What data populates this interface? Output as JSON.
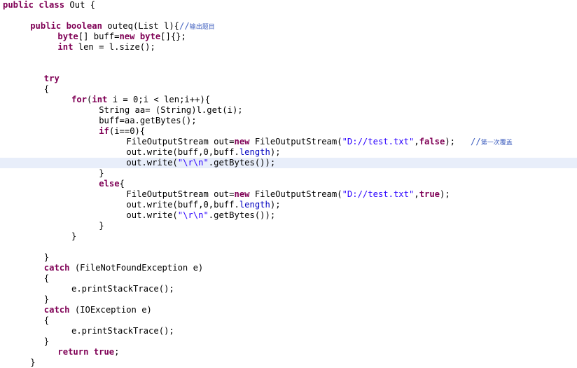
{
  "editor": {
    "language": "Java",
    "class_name": "Out",
    "method_name": "outeq",
    "highlighted_line_number": 15,
    "colors": {
      "background": "#FFFFFF",
      "foreground": "#000000",
      "keyword": "#7F0055",
      "string": "#2A00FF",
      "comment": "#3F5FBF",
      "current_line_highlight": "#E8EEFA"
    }
  },
  "code": {
    "lines": [
      {
        "n": 1,
        "indent": 0,
        "highlight": false,
        "tokens": [
          {
            "t": "kw",
            "v": "public"
          },
          {
            "t": "plain",
            "v": " "
          },
          {
            "t": "kw",
            "v": "class"
          },
          {
            "t": "plain",
            "v": " Out {"
          }
        ]
      },
      {
        "n": 2,
        "indent": 0,
        "highlight": false,
        "tokens": []
      },
      {
        "n": 3,
        "indent": 2,
        "highlight": false,
        "tokens": [
          {
            "t": "kw",
            "v": "public"
          },
          {
            "t": "plain",
            "v": " "
          },
          {
            "t": "kw",
            "v": "boolean"
          },
          {
            "t": "plain",
            "v": " outeq(List l){"
          },
          {
            "t": "cmt",
            "v": "//"
          },
          {
            "t": "cmt-cjk",
            "v": "输出题目"
          }
        ]
      },
      {
        "n": 4,
        "indent": 4,
        "highlight": false,
        "tokens": [
          {
            "t": "kw",
            "v": "byte"
          },
          {
            "t": "plain",
            "v": "[] buff="
          },
          {
            "t": "kw",
            "v": "new"
          },
          {
            "t": "plain",
            "v": " "
          },
          {
            "t": "kw",
            "v": "byte"
          },
          {
            "t": "plain",
            "v": "[]{};"
          }
        ]
      },
      {
        "n": 5,
        "indent": 4,
        "highlight": false,
        "tokens": [
          {
            "t": "kw",
            "v": "int"
          },
          {
            "t": "plain",
            "v": " len = l.size();"
          }
        ]
      },
      {
        "n": 6,
        "indent": 0,
        "highlight": false,
        "tokens": []
      },
      {
        "n": 7,
        "indent": 0,
        "highlight": false,
        "tokens": []
      },
      {
        "n": 8,
        "indent": 3,
        "highlight": false,
        "tokens": [
          {
            "t": "kw",
            "v": "try"
          }
        ]
      },
      {
        "n": 9,
        "indent": 3,
        "highlight": false,
        "tokens": [
          {
            "t": "plain",
            "v": "{"
          }
        ]
      },
      {
        "n": 10,
        "indent": 5,
        "highlight": false,
        "tokens": [
          {
            "t": "kw",
            "v": "for"
          },
          {
            "t": "plain",
            "v": "("
          },
          {
            "t": "kw",
            "v": "int"
          },
          {
            "t": "plain",
            "v": " i = 0;i < len;i++){"
          }
        ]
      },
      {
        "n": 11,
        "indent": 7,
        "highlight": false,
        "tokens": [
          {
            "t": "plain",
            "v": "String aa= (String)l.get(i);"
          }
        ]
      },
      {
        "n": 12,
        "indent": 7,
        "highlight": false,
        "tokens": [
          {
            "t": "plain",
            "v": "buff=aa.getBytes();"
          }
        ]
      },
      {
        "n": 13,
        "indent": 7,
        "highlight": false,
        "tokens": [
          {
            "t": "kw",
            "v": "if"
          },
          {
            "t": "plain",
            "v": "(i==0){"
          }
        ]
      },
      {
        "n": 14,
        "indent": 9,
        "highlight": false,
        "tokens": [
          {
            "t": "plain",
            "v": "FileOutputStream out="
          },
          {
            "t": "kw",
            "v": "new"
          },
          {
            "t": "plain",
            "v": " FileOutputStream("
          },
          {
            "t": "str",
            "v": "\"D://test.txt\""
          },
          {
            "t": "plain",
            "v": ","
          },
          {
            "t": "kw",
            "v": "false"
          },
          {
            "t": "plain",
            "v": ");   "
          },
          {
            "t": "cmt",
            "v": "//"
          },
          {
            "t": "cmt-cjk",
            "v": "第一次覆盖"
          }
        ]
      },
      {
        "n": 15,
        "indent": 9,
        "highlight": false,
        "tokens": [
          {
            "t": "plain",
            "v": "out.write(buff,0,buff."
          },
          {
            "t": "fld",
            "v": "length"
          },
          {
            "t": "plain",
            "v": ");"
          }
        ]
      },
      {
        "n": 16,
        "indent": 9,
        "highlight": true,
        "tokens": [
          {
            "t": "plain",
            "v": "out.write("
          },
          {
            "t": "str",
            "v": "\"\\r\\n\""
          },
          {
            "t": "plain",
            "v": ".getBytes());"
          }
        ]
      },
      {
        "n": 17,
        "indent": 7,
        "highlight": false,
        "tokens": [
          {
            "t": "plain",
            "v": "}"
          }
        ]
      },
      {
        "n": 18,
        "indent": 7,
        "highlight": false,
        "tokens": [
          {
            "t": "kw",
            "v": "else"
          },
          {
            "t": "plain",
            "v": "{"
          }
        ]
      },
      {
        "n": 19,
        "indent": 9,
        "highlight": false,
        "tokens": [
          {
            "t": "plain",
            "v": "FileOutputStream out="
          },
          {
            "t": "kw",
            "v": "new"
          },
          {
            "t": "plain",
            "v": " FileOutputStream("
          },
          {
            "t": "str",
            "v": "\"D://test.txt\""
          },
          {
            "t": "plain",
            "v": ","
          },
          {
            "t": "kw",
            "v": "true"
          },
          {
            "t": "plain",
            "v": ");"
          }
        ]
      },
      {
        "n": 20,
        "indent": 9,
        "highlight": false,
        "tokens": [
          {
            "t": "plain",
            "v": "out.write(buff,0,buff."
          },
          {
            "t": "fld",
            "v": "length"
          },
          {
            "t": "plain",
            "v": ");"
          }
        ]
      },
      {
        "n": 21,
        "indent": 9,
        "highlight": false,
        "tokens": [
          {
            "t": "plain",
            "v": "out.write("
          },
          {
            "t": "str",
            "v": "\"\\r\\n\""
          },
          {
            "t": "plain",
            "v": ".getBytes());"
          }
        ]
      },
      {
        "n": 22,
        "indent": 7,
        "highlight": false,
        "tokens": [
          {
            "t": "plain",
            "v": "}"
          }
        ]
      },
      {
        "n": 23,
        "indent": 5,
        "highlight": false,
        "tokens": [
          {
            "t": "plain",
            "v": "}"
          }
        ]
      },
      {
        "n": 24,
        "indent": 0,
        "highlight": false,
        "tokens": []
      },
      {
        "n": 25,
        "indent": 3,
        "highlight": false,
        "tokens": [
          {
            "t": "plain",
            "v": "}"
          }
        ]
      },
      {
        "n": 26,
        "indent": 3,
        "highlight": false,
        "tokens": [
          {
            "t": "kw",
            "v": "catch"
          },
          {
            "t": "plain",
            "v": " (FileNotFoundException e)"
          }
        ]
      },
      {
        "n": 27,
        "indent": 3,
        "highlight": false,
        "tokens": [
          {
            "t": "plain",
            "v": "{"
          }
        ]
      },
      {
        "n": 28,
        "indent": 5,
        "highlight": false,
        "tokens": [
          {
            "t": "plain",
            "v": "e.printStackTrace();"
          }
        ]
      },
      {
        "n": 29,
        "indent": 3,
        "highlight": false,
        "tokens": [
          {
            "t": "plain",
            "v": "}"
          }
        ]
      },
      {
        "n": 30,
        "indent": 3,
        "highlight": false,
        "tokens": [
          {
            "t": "kw",
            "v": "catch"
          },
          {
            "t": "plain",
            "v": " (IOException e)"
          }
        ]
      },
      {
        "n": 31,
        "indent": 3,
        "highlight": false,
        "tokens": [
          {
            "t": "plain",
            "v": "{"
          }
        ]
      },
      {
        "n": 32,
        "indent": 5,
        "highlight": false,
        "tokens": [
          {
            "t": "plain",
            "v": "e.printStackTrace();"
          }
        ]
      },
      {
        "n": 33,
        "indent": 3,
        "highlight": false,
        "tokens": [
          {
            "t": "plain",
            "v": "}"
          }
        ]
      },
      {
        "n": 34,
        "indent": 4,
        "highlight": false,
        "tokens": [
          {
            "t": "kw",
            "v": "return"
          },
          {
            "t": "plain",
            "v": " "
          },
          {
            "t": "kw",
            "v": "true"
          },
          {
            "t": "plain",
            "v": ";"
          }
        ]
      },
      {
        "n": 35,
        "indent": 2,
        "highlight": false,
        "tokens": [
          {
            "t": "plain",
            "v": "}"
          }
        ]
      }
    ]
  }
}
